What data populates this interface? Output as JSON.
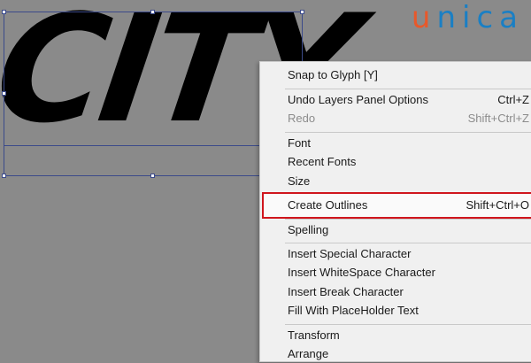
{
  "canvas": {
    "text_frame_content": "CITY"
  },
  "logo": {
    "first": "u",
    "rest": "nica",
    "accent_color": "#e8582a",
    "brand_color": "#1a7fc4"
  },
  "context_menu": {
    "items": [
      {
        "label": "Snap to Glyph [Y]",
        "shortcut": ""
      },
      {
        "label": "Undo Layers Panel Options",
        "shortcut": "Ctrl+Z"
      },
      {
        "label": "Redo",
        "shortcut": "Shift+Ctrl+Z",
        "disabled": true
      },
      {
        "label": "Font",
        "shortcut": ""
      },
      {
        "label": "Recent Fonts",
        "shortcut": ""
      },
      {
        "label": "Size",
        "shortcut": ""
      },
      {
        "label": "Create Outlines",
        "shortcut": "Shift+Ctrl+O",
        "highlighted": true
      },
      {
        "label": "Spelling",
        "shortcut": ""
      },
      {
        "label": "Insert Special Character",
        "shortcut": ""
      },
      {
        "label": "Insert WhiteSpace Character",
        "shortcut": ""
      },
      {
        "label": "Insert Break Character",
        "shortcut": ""
      },
      {
        "label": "Fill With PlaceHolder Text",
        "shortcut": ""
      },
      {
        "label": "Transform",
        "shortcut": ""
      },
      {
        "label": "Arrange",
        "shortcut": ""
      }
    ],
    "highlight_color": "#d0161d"
  }
}
